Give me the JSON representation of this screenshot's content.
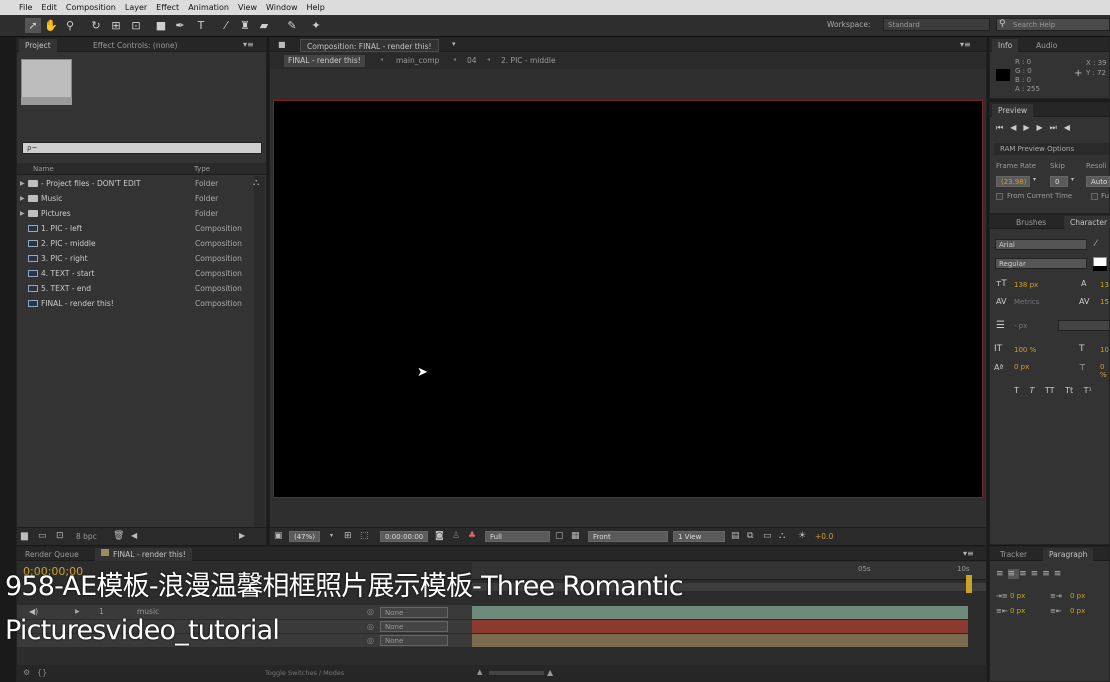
{
  "menu": [
    "File",
    "Edit",
    "Composition",
    "Layer",
    "Effect",
    "Animation",
    "View",
    "Window",
    "Help"
  ],
  "toolbar": {
    "workspace_label": "Workspace:",
    "workspace_value": "Standard",
    "search_placeholder": "Search Help"
  },
  "project": {
    "tabs": [
      "Project",
      "Effect Controls: (none)"
    ],
    "search_placeholder": "ρ~",
    "columns": [
      "Name",
      "Type"
    ],
    "items": [
      {
        "name": "- Project files - DON'T EDIT",
        "type": "Folder",
        "kind": "folder"
      },
      {
        "name": "Music",
        "type": "Folder",
        "kind": "folder"
      },
      {
        "name": "Pictures",
        "type": "Folder",
        "kind": "folder"
      },
      {
        "name": "1. PIC - left",
        "type": "Composition",
        "kind": "comp"
      },
      {
        "name": "2. PIC - middle",
        "type": "Composition",
        "kind": "comp"
      },
      {
        "name": "3. PIC - right",
        "type": "Composition",
        "kind": "comp"
      },
      {
        "name": "4. TEXT - start",
        "type": "Composition",
        "kind": "comp"
      },
      {
        "name": "5. TEXT - end",
        "type": "Composition",
        "kind": "comp"
      },
      {
        "name": "FINAL - render this!",
        "type": "Composition",
        "kind": "comp"
      }
    ],
    "bpc": "8 bpc"
  },
  "composition": {
    "tab": "Composition: FINAL - render this!",
    "breadcrumbs": [
      "FINAL - render this!",
      "main_comp",
      "04",
      "2. PIC - middle"
    ],
    "zoom": "(47%)",
    "timecode": "0:00:00:00",
    "resolution": "Full",
    "view": "Front",
    "views": "1 View",
    "exposure": "+0.0"
  },
  "info": {
    "tabs": [
      "Info",
      "Audio"
    ],
    "r": "R : 0",
    "g": "G : 0",
    "b": "B : 0",
    "a": "A : 255",
    "x": "X : 39",
    "y": "Y : 72"
  },
  "preview": {
    "tab": "Preview",
    "ram": "RAM Preview Options",
    "frame_rate_label": "Frame Rate",
    "skip_label": "Skip",
    "resolution_label": "Resoli",
    "frame_rate": "(23.98)",
    "skip": "0",
    "resolution": "Auto",
    "from_current": "From Current Time",
    "fu": "Fu"
  },
  "character": {
    "tabs": [
      "Brushes",
      "Character"
    ],
    "font": "Arial",
    "style": "Regular",
    "size": "138 px",
    "leading": "13",
    "kerning": "Metrics",
    "tracking": "15",
    "line": "- px",
    "vscale": "100 %",
    "hscale": "10",
    "baseline": "0 px",
    "tsume": "0 %"
  },
  "timeline": {
    "tabs": [
      "Render Queue",
      "FINAL - render this!"
    ],
    "timecode": "0;00;00;00",
    "layer_num": "1",
    "layer_name": "music",
    "parent": "None",
    "ruler": [
      "05s",
      "10s"
    ],
    "toggle_label": "Toggle Switches / Modes"
  },
  "right_bottom": {
    "tabs": [
      "Tracker",
      "Paragraph"
    ],
    "px": "0 px"
  },
  "overlay": {
    "line1": "958-AE模板-浪漫温馨相框照片展示模板-Three Romantic",
    "line2": "Picturesvideo_tutorial"
  }
}
